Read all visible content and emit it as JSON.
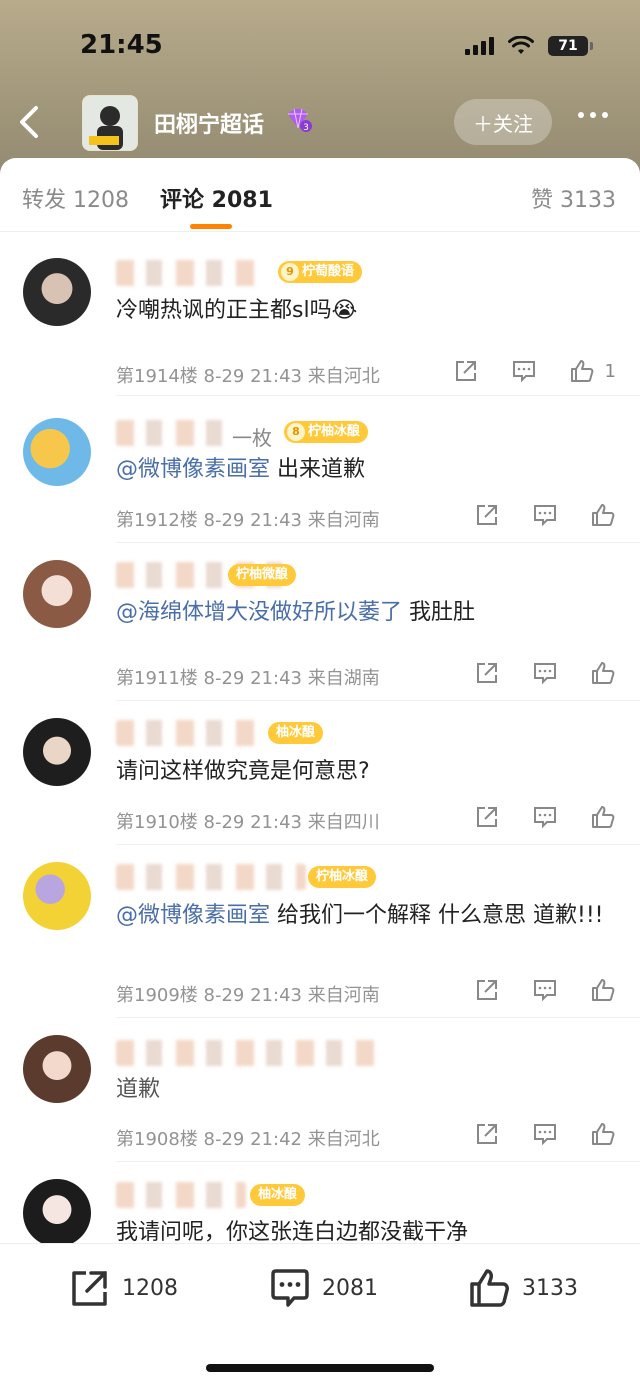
{
  "status_bar": {
    "time": "21:45",
    "battery": "71"
  },
  "header": {
    "title": "田栩宁超话",
    "follow_label": "＋关注"
  },
  "tabs": [
    {
      "label": "转发 1208",
      "active": false
    },
    {
      "label": "评论 2081",
      "active": true
    },
    {
      "label": "赞 3133",
      "active": false
    }
  ],
  "comments": [
    {
      "name_visible": "uuu",
      "level": "9",
      "badge": "柠萄酸语",
      "text": "冷嘲热讽的正主都sl吗😭",
      "meta": "第1914楼 8-29 21:43 来自河北",
      "likes": "1"
    },
    {
      "name_visible": "一枚",
      "level": "8",
      "badge": "柠柚冰酿",
      "mention": "@微博像素画室",
      "text": " 出来道歉",
      "meta": "第1912楼 8-29 21:43 来自河南",
      "likes": ""
    },
    {
      "name_visible": "",
      "level": "",
      "badge": "柠柚微酿",
      "mention": "@海绵体增大没做好所以萎了",
      "text": " 我肚肚",
      "meta": "第1911楼 8-29 21:43 来自湖南",
      "likes": ""
    },
    {
      "name_visible": "",
      "level": "",
      "badge": "柚冰酿",
      "text": "请问这样做究竟是何意思?",
      "meta": "第1910楼 8-29 21:43 来自四川",
      "likes": ""
    },
    {
      "name_visible": "",
      "level": "",
      "badge": "柠柚冰酿",
      "mention": "@微博像素画室",
      "text": " 给我们一个解释 什么意思 道歉!!!",
      "meta": "第1909楼 8-29 21:43 来自河南",
      "likes": ""
    },
    {
      "name_visible": "",
      "level": "",
      "badge": "",
      "text": "道歉",
      "meta": "第1908楼 8-29 21:42 来自河北",
      "likes": ""
    },
    {
      "name_visible": "",
      "level": "",
      "badge": "柚冰酿",
      "text": "我请问呢，你这张连白边都没截干净",
      "meta": "",
      "likes": ""
    }
  ],
  "bottom_bar": {
    "reposts": "1208",
    "comments": "2081",
    "likes": "3133"
  },
  "colors": {
    "accent": "#ff8200",
    "mention": "#4a6ea8",
    "level_badge": "#ffc93a"
  }
}
